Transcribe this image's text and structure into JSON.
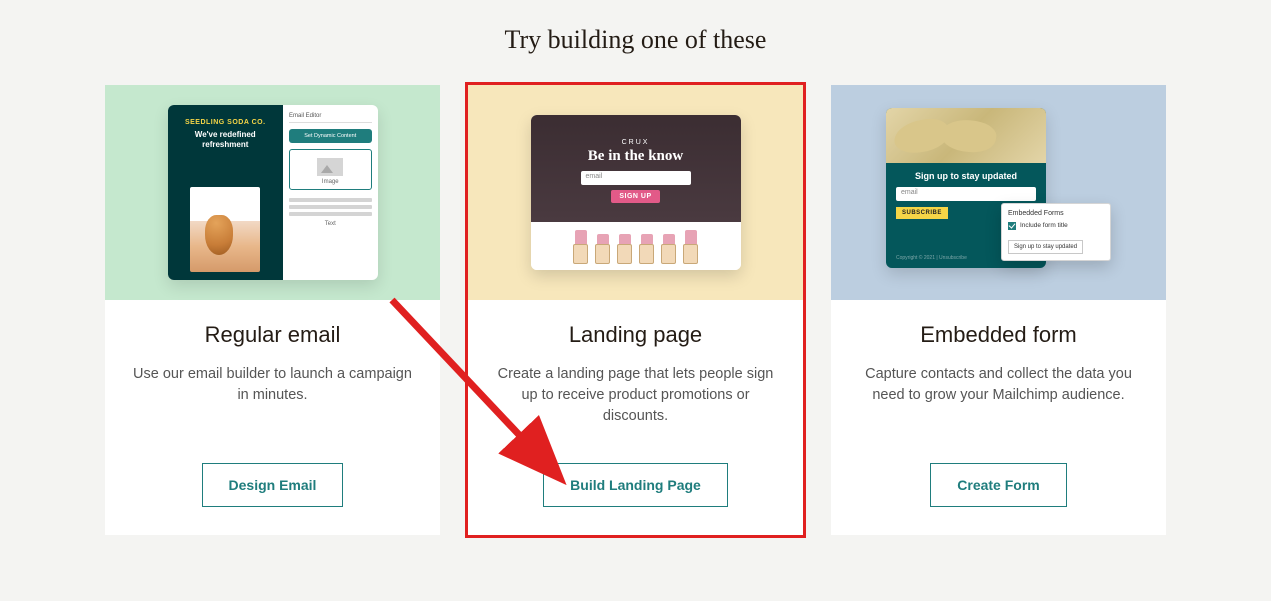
{
  "page_title": "Try building one of these",
  "cards": [
    {
      "title": "Regular email",
      "description": "Use our email builder to launch a campaign in minutes.",
      "button": "Design Email",
      "illustration": {
        "editor_label": "Email Editor",
        "brand": "SEEDLING SODA CO.",
        "tagline": "We've redefined refreshment",
        "dynamic_button": "Set Dynamic Content",
        "image_label": "Image",
        "text_label": "Text"
      }
    },
    {
      "title": "Landing page",
      "description": "Create a landing page that lets people sign up to receive product promotions or discounts.",
      "button": "Build Landing Page",
      "illustration": {
        "brand": "CRUX",
        "heading": "Be in the know",
        "input_placeholder": "email",
        "signup_button": "SIGN UP"
      }
    },
    {
      "title": "Embedded form",
      "description": "Capture contacts and collect the data you need to grow your Mailchimp audience.",
      "button": "Create Form",
      "illustration": {
        "heading": "Sign up to stay updated",
        "input_placeholder": "email",
        "subscribe_button": "SUBSCRIBE",
        "popup_title": "Embedded Forms",
        "popup_option": "Include form title",
        "popup_button": "Sign up to stay updated"
      }
    }
  ],
  "annotation": {
    "highlighted_card_index": 1,
    "arrow_color": "#e02020"
  }
}
